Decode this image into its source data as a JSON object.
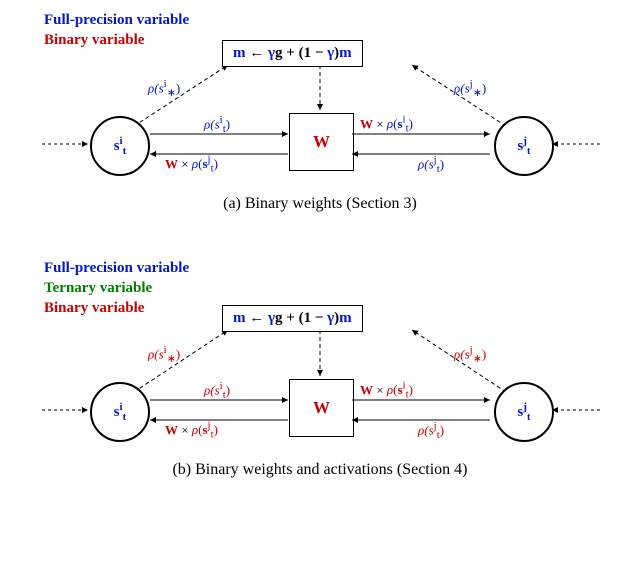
{
  "legend": {
    "full_precision": "Full-precision variable",
    "ternary": "Ternary variable",
    "binary": "Binary variable"
  },
  "eq": {
    "m_lhs": "m",
    "arrow": " ← ",
    "gamma": "γ",
    "g": "g",
    "plus": " + (1 − ",
    "gamma2": "γ",
    "rparen": ")",
    "m_rhs": "m"
  },
  "W": "W",
  "node_si": {
    "s": "s",
    "sub": "t",
    "sup": "i"
  },
  "node_sj": {
    "s": "s",
    "sub": "t",
    "sup": "j"
  },
  "labels": {
    "rho_si_star": "ρ(s",
    "rho_si_star_sup": "i",
    "rho_si_star_sub": "∗",
    "rho_close": ")",
    "rho_sj_star": "ρ(s",
    "rho_sj_star_sup": "j",
    "rho_sj_star_sub": "∗",
    "rho_si_t": "ρ(s",
    "rho_si_t_sup": "i",
    "rho_si_t_sub": "t",
    "rho_sj_t": "ρ(s",
    "rho_sj_t_sup": "j",
    "rho_sj_t_sub": "t",
    "W_times_i": "W × ρ(s",
    "W_times_i_sup": "i",
    "W_times_i_sub": "t",
    "W_times_j": "W × ρ(s",
    "W_times_j_sup": "j",
    "W_times_j_sub": "t"
  },
  "captions": {
    "a": "(a) Binary weights (Section 3)",
    "b": "(b) Binary weights and activations (Section 4)"
  }
}
